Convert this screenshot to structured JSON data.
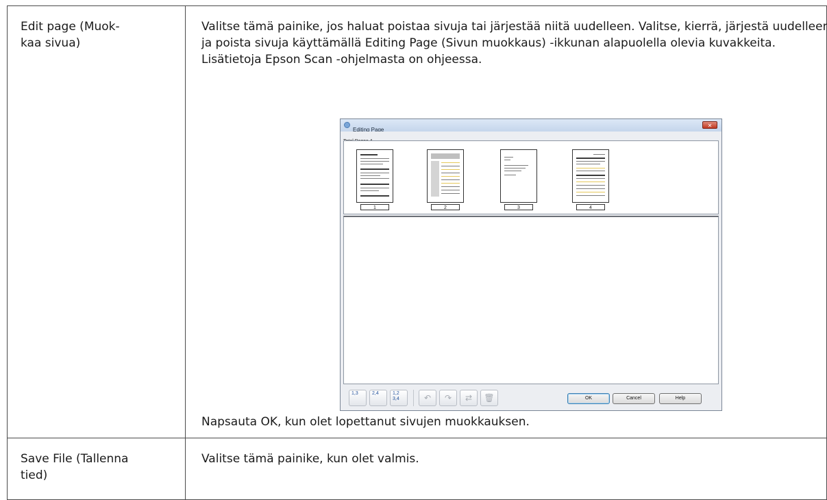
{
  "rows": [
    {
      "term": "Edit page (Muok-\nkaa sivua)",
      "paragraphs": [
        "Valitse tämä painike, jos haluat poistaa sivuja tai järjestää niitä uudelleen. Valitse, kierrä, järjestä uudelleen ja poista sivuja käyttämällä Editing Page (Sivun muokkaus) -ikkunan alapuolella olevia kuvakkeita.",
        "Lisätietoja Epson Scan -ohjelmasta on ohjeessa."
      ],
      "footer": "Napsauta OK, kun olet lopettanut sivujen muokkauksen."
    },
    {
      "term": "Save File (Tallenna\ntied)",
      "paragraphs": [
        "Valitse tämä painike, kun olet valmis."
      ]
    }
  ],
  "dialog": {
    "title": "Editing Page",
    "close_label": "✕",
    "total_pages": "Total Pages 4",
    "pages": [
      "1",
      "2",
      "3",
      "4"
    ],
    "tools": {
      "odd_label": "1,3",
      "even_label": "2,4",
      "all_label": "1,2\n3,4"
    },
    "buttons": {
      "ok": "OK",
      "cancel": "Cancel",
      "help": "Help"
    }
  }
}
